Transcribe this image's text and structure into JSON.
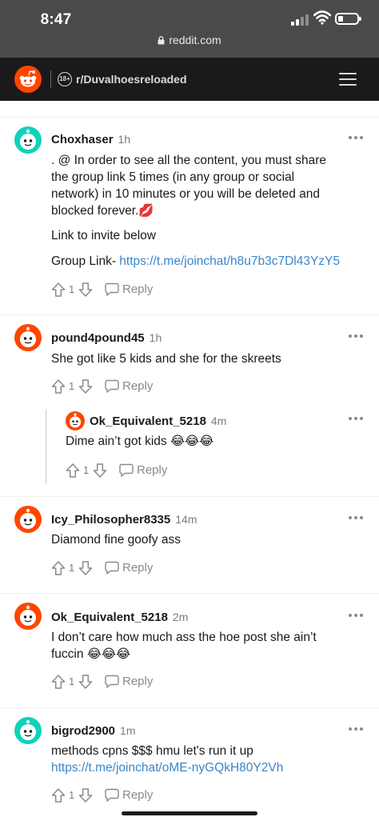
{
  "status_bar": {
    "time": "8:47",
    "url": "reddit.com"
  },
  "header": {
    "subreddit": "r/Duvalhoesreloaded",
    "nsfw_badge": "18+"
  },
  "reply_label": "Reply",
  "comments": [
    {
      "author": "Choxhaser",
      "age": "1h",
      "lines": [
        ". @ In order to see all the content, you must share",
        "the group link 5 times (in any group or social",
        "network) in 10 minutes or you will be deleted and",
        "blocked forever.💋"
      ],
      "invite_text": "Link to invite below",
      "group_link_label": "Group Link-",
      "group_link_url": "https://t.me/joinchat/h8u7b3c7Dl43YzY5",
      "votes": "1",
      "avatar_color": "#0dd3bb"
    },
    {
      "author": "pound4pound45",
      "age": "1h",
      "text": "She got like 5 kids and she for the skreets",
      "votes": "1",
      "avatar_color": "#ff4500"
    },
    {
      "author": "Ok_Equivalent_5218",
      "age": "4m",
      "text": "Dime ain’t got kids 😂😂😂",
      "votes": "1",
      "avatar_color": "#ff4500"
    },
    {
      "author": "Icy_Philosopher8335",
      "age": "14m",
      "text": "Diamond fine goofy ass",
      "votes": "1",
      "avatar_color": "#ff4500"
    },
    {
      "author": "Ok_Equivalent_5218",
      "age": "2m",
      "line1": "I don’t care how much ass the hoe post she ain’t",
      "line2": "fuccin 😂😂😂",
      "votes": "1",
      "avatar_color": "#ff4500"
    },
    {
      "author": "bigrod2900",
      "age": "1m",
      "text": "methods cpns $$$ hmu let's run it up",
      "link": "https://t.me/joinchat/oME-nyGQkH80Y2Vh",
      "votes": "1",
      "avatar_color": "#0dd3bb"
    }
  ]
}
